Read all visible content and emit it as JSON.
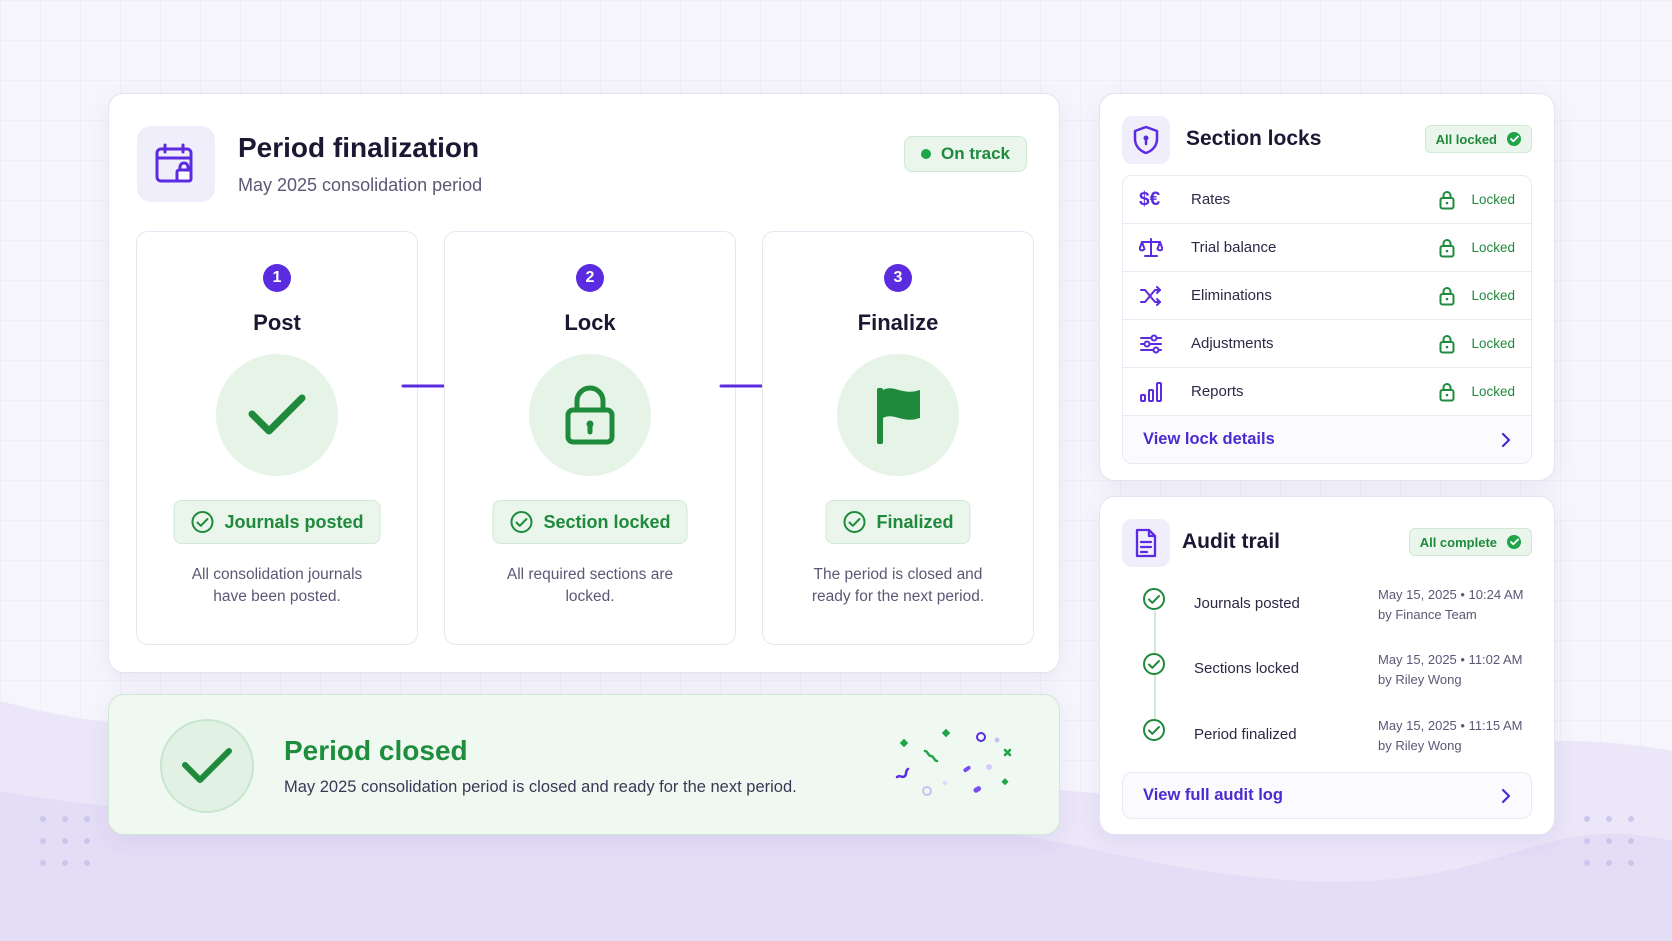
{
  "main": {
    "title": "Period finalization",
    "subtitle": "May 2025 consolidation period",
    "status": "On track",
    "steps": [
      {
        "number": "1",
        "title": "Post",
        "status": "Journals posted",
        "description": "All consolidation journals have been posted.",
        "icon": "check-icon"
      },
      {
        "number": "2",
        "title": "Lock",
        "status": "Section locked",
        "description": "All required sections are locked.",
        "icon": "lock-icon"
      },
      {
        "number": "3",
        "title": "Finalize",
        "status": "Finalized",
        "description": "The period is closed and ready for the next period.",
        "icon": "flag-icon"
      }
    ]
  },
  "banner": {
    "title": "Period closed",
    "text": "May 2025 consolidation period is closed and ready for the next period."
  },
  "section_locks": {
    "title": "Section locks",
    "badge": "All locked",
    "items": [
      {
        "icon": "currency-icon",
        "label": "Rates",
        "status": "Locked"
      },
      {
        "icon": "scale-icon",
        "label": "Trial balance",
        "status": "Locked"
      },
      {
        "icon": "shuffle-icon",
        "label": "Eliminations",
        "status": "Locked"
      },
      {
        "icon": "sliders-icon",
        "label": "Adjustments",
        "status": "Locked"
      },
      {
        "icon": "bar-chart-icon",
        "label": "Reports",
        "status": "Locked"
      }
    ],
    "link": "View lock details"
  },
  "audit_trail": {
    "title": "Audit trail",
    "badge": "All complete",
    "events": [
      {
        "event": "Journals posted",
        "time": "May 15, 2025 • 10:24 AM",
        "by": "by Finance Team"
      },
      {
        "event": "Sections locked",
        "time": "May 15, 2025 • 11:02 AM",
        "by": "by Riley Wong"
      },
      {
        "event": "Period finalized",
        "time": "May 15, 2025 • 11:15 AM",
        "by": "by Riley Wong"
      }
    ],
    "link": "View full audit log"
  },
  "colors": {
    "accent": "#5b2be0",
    "success": "#1fa447",
    "success_bg": "#e6f4e8"
  }
}
